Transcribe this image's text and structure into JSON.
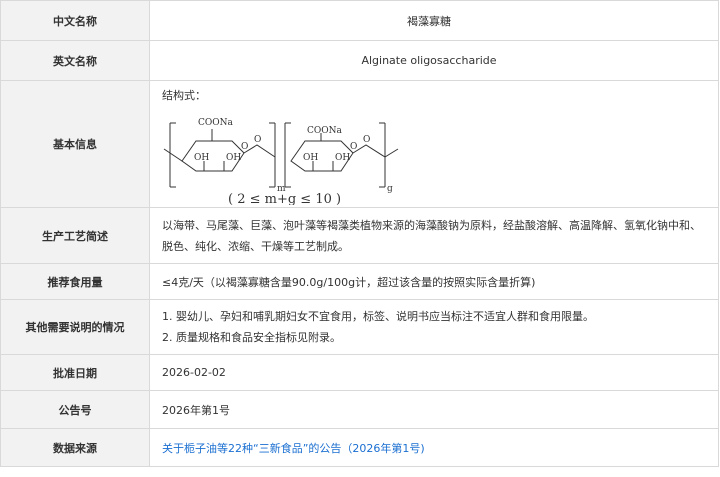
{
  "rows": {
    "cn_name": {
      "label": "中文名称",
      "value": "褐藻寡糖"
    },
    "en_name": {
      "label": "英文名称",
      "value": "Alginate oligosaccharide"
    },
    "basic": {
      "label": "基本信息",
      "structure_label": "结构式：",
      "formula_glyphs": {
        "group": "COONa",
        "hydroxyl": "OH",
        "oxygen": "O",
        "sub_m": "m",
        "sub_g": "g",
        "constraint": "( 2 ≤ m+g ≤ 10 )"
      }
    },
    "process": {
      "label": "生产工艺简述",
      "value": "以海带、马尾藻、巨藻、泡叶藻等褐藻类植物来源的海藻酸钠为原料，经盐酸溶解、高温降解、氢氧化钠中和、脱色、纯化、浓缩、干燥等工艺制成。"
    },
    "intake": {
      "label": "推荐食用量",
      "value": "≤4克/天（以褐藻寡糖含量90.0g/100g计，超过该含量的按照实际含量折算)"
    },
    "notes": {
      "label": "其他需要说明的情况",
      "items": [
        "1. 婴幼儿、孕妇和哺乳期妇女不宜食用，标签、说明书应当标注不适宜人群和食用限量。",
        "2. 质量规格和食品安全指标见附录。"
      ]
    },
    "approval_date": {
      "label": "批准日期",
      "value": "2026-02-02"
    },
    "bulletin_no": {
      "label": "公告号",
      "value": "2026年第1号"
    },
    "source": {
      "label": "数据来源",
      "value": "关于栀子油等22种“三新食品”的公告（2026年第1号)"
    }
  },
  "colors": {
    "label_bg": "#f2f2f2",
    "border": "#d9d9d9",
    "link": "#1a6fd1",
    "text": "#333333"
  }
}
